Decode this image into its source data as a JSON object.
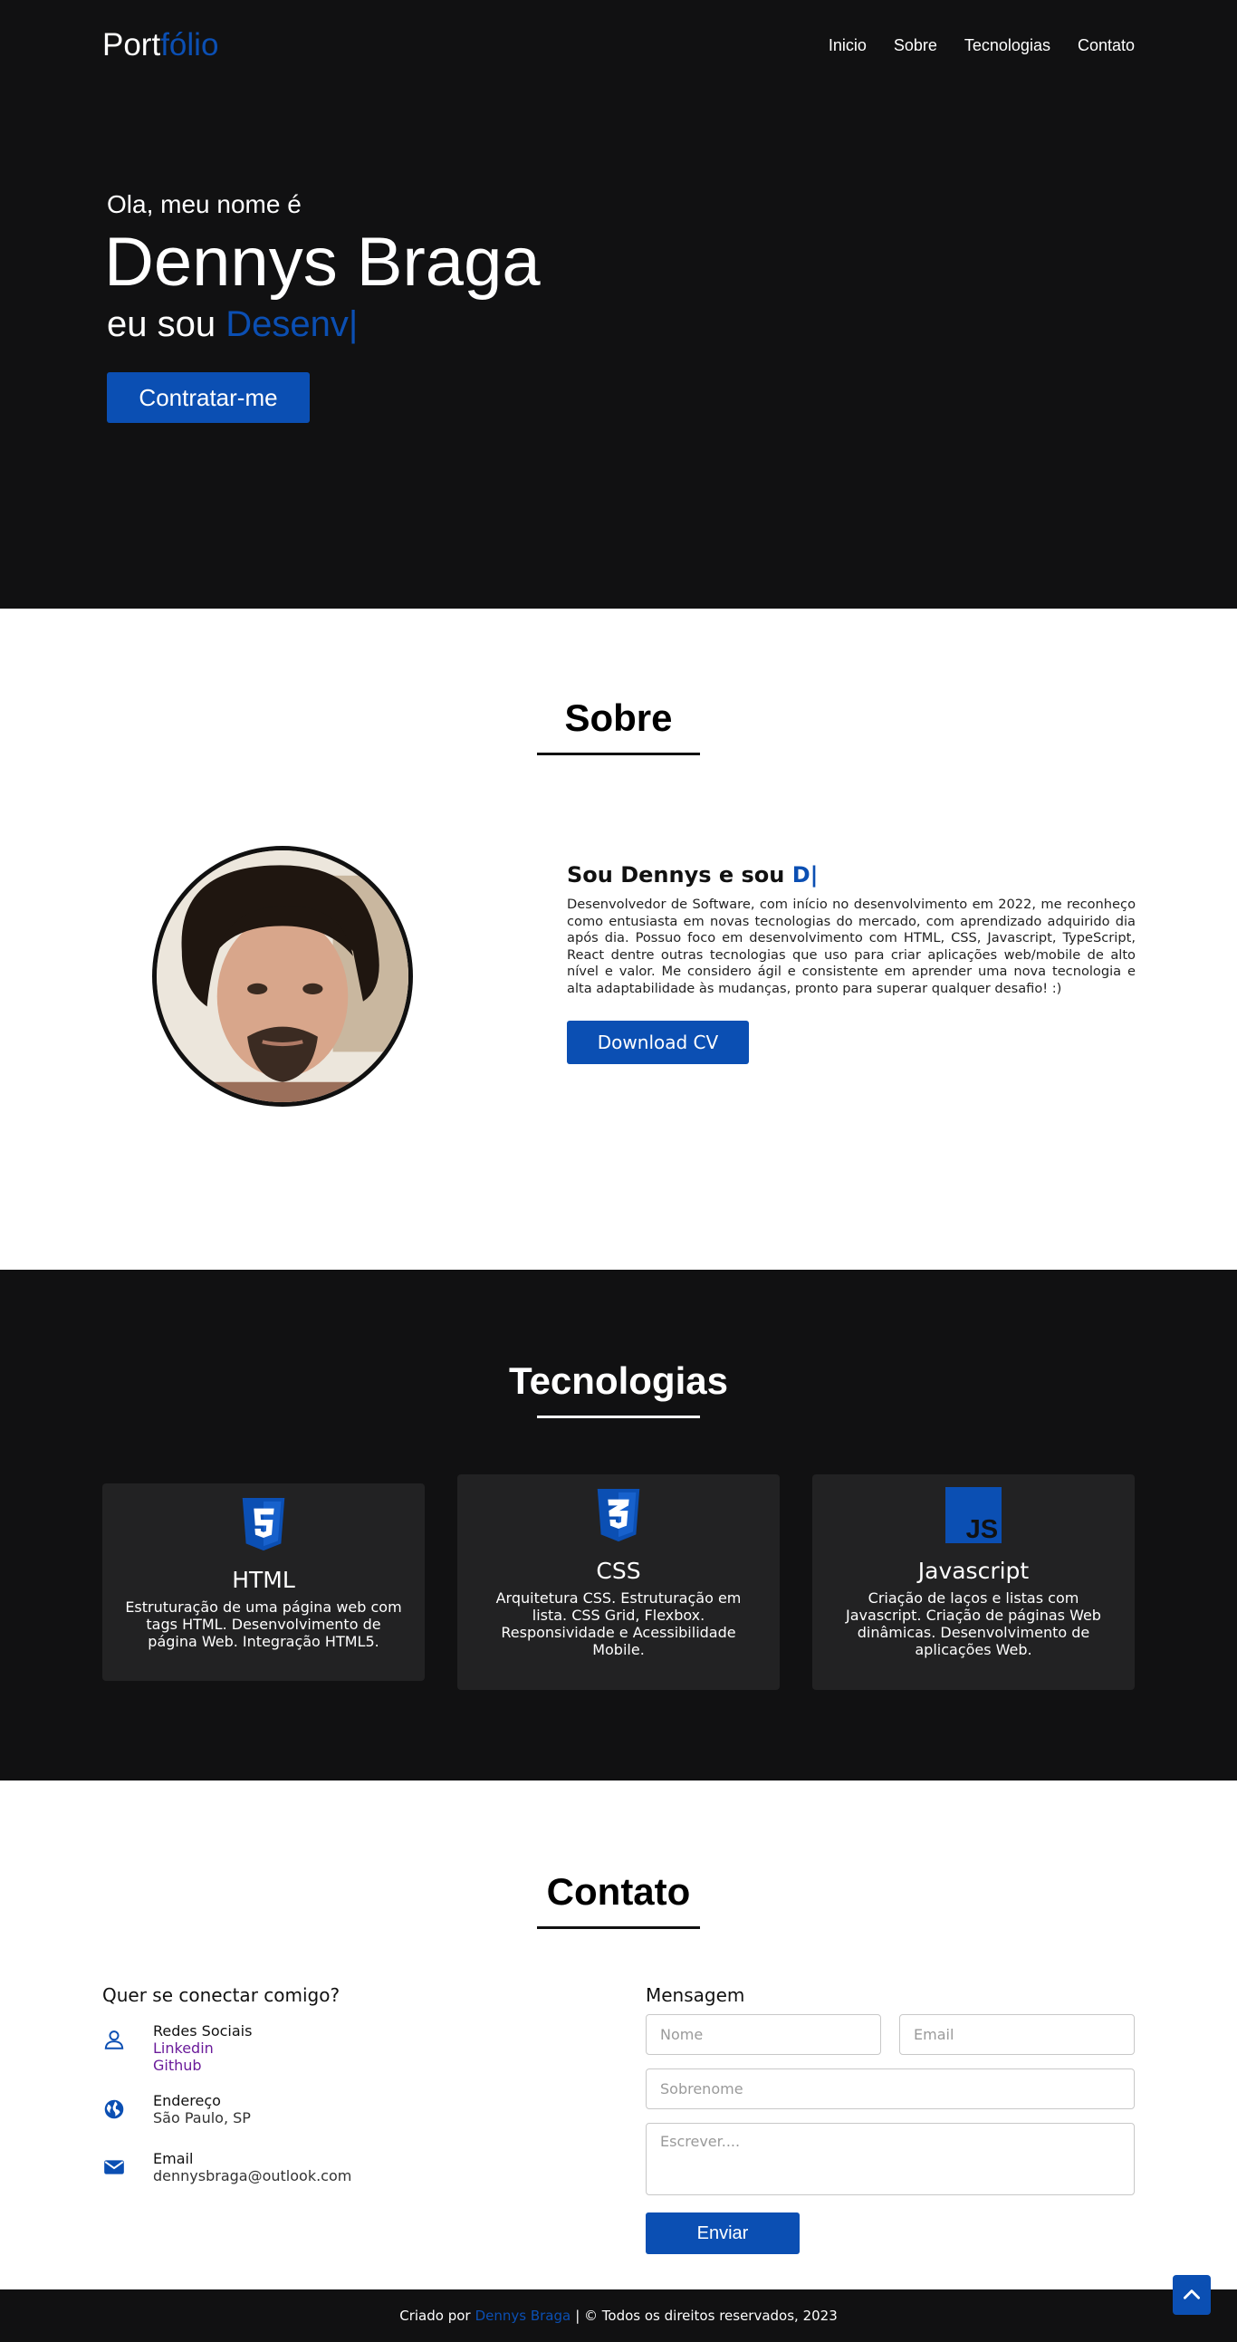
{
  "brand": {
    "logo_prefix": "Port",
    "logo_accent": "fólio",
    "accent_color": "#0b4fb3",
    "dark_bg": "#111112"
  },
  "nav": {
    "items": [
      "Inicio",
      "Sobre",
      "Tecnologias",
      "Contato"
    ]
  },
  "hero": {
    "greeting": "Ola, meu nome é",
    "name": "Dennys Braga",
    "role_prefix": "eu sou",
    "role_typed": "Desenv|",
    "cta_label": "Contratar-me"
  },
  "sobre": {
    "title": "Sobre",
    "heading_prefix": "Sou Dennys e sou",
    "heading_typed": "D|",
    "description": "Desenvolvedor de Software, com início no desenvolvimento em 2022, me reconheço como entusiasta em novas tecnologias do mercado, com aprendizado adquirido dia após dia. Possuo foco em desenvolvimento com HTML, CSS, Javascript, TypeScript, React dentre outras tecnologias que uso para criar aplicações web/mobile de alto nível e valor. Me considero ágil e consistente em aprender uma nova tecnologia e alta adaptabilidade às mudanças, pronto para superar qualquer desafio! :)",
    "cv_label": "Download CV"
  },
  "tecnologias": {
    "title": "Tecnologias",
    "cards": [
      {
        "icon": "html5-icon",
        "title": "HTML",
        "desc": "Estruturação de uma página web com tags HTML. Desenvolvimento de página Web. Integração HTML5."
      },
      {
        "icon": "css3-icon",
        "title": "CSS",
        "desc": "Arquitetura CSS. Estruturação em lista. CSS Grid, Flexbox. Responsividade e Acessibilidade Mobile."
      },
      {
        "icon": "javascript-icon",
        "title": "Javascript",
        "desc": "Criação de laços e listas com Javascript. Criação de páginas Web dinâmicas. Desenvolvimento de aplicações Web."
      }
    ]
  },
  "contato": {
    "title": "Contato",
    "question": "Quer se conectar comigo?",
    "social_label": "Redes Sociais",
    "linkedin": "Linkedin",
    "github": "Github",
    "address_label": "Endereço",
    "address_value": "São Paulo, SP",
    "email_label": "Email",
    "email_value": "dennysbraga@outlook.com",
    "form": {
      "title": "Mensagem",
      "nome_placeholder": "Nome",
      "email_placeholder": "Email",
      "sobrenome_placeholder": "Sobrenome",
      "message_placeholder": "Escrever....",
      "send_label": "Enviar"
    }
  },
  "footer": {
    "prefix": "Criado por",
    "author": "Dennys Braga",
    "suffix": "| © Todos os direitos reservados, 2023"
  }
}
